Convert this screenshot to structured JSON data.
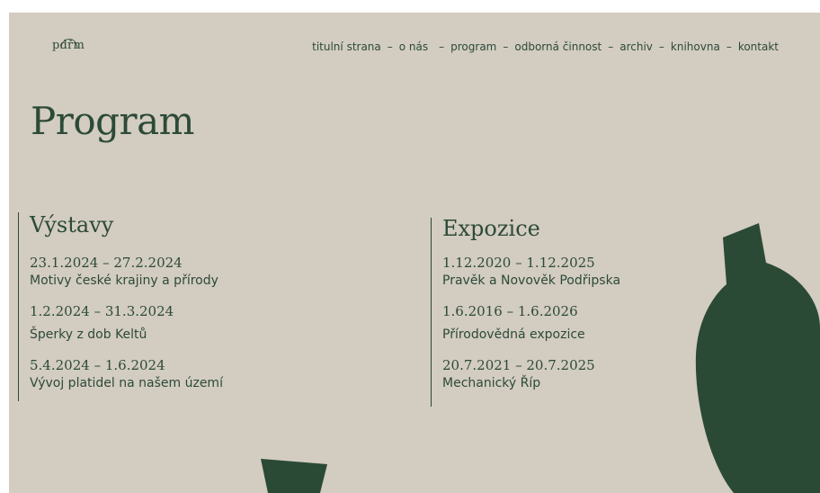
{
  "header": {
    "logo_text": "pdřm",
    "nav": [
      {
        "label": "titulní strana"
      },
      {
        "label": "o nás"
      },
      {
        "label": "program"
      },
      {
        "label": "odborná činnost"
      },
      {
        "label": "archiv"
      },
      {
        "label": "knihovna"
      },
      {
        "label": "kontakt"
      }
    ],
    "separator": "–"
  },
  "main": {
    "title": "Program",
    "vystavy": {
      "title": "Výstavy",
      "items": [
        {
          "date": "23.1.2024 – 27.2.2024",
          "name": "Motivy české krajiny a přírody"
        },
        {
          "date": "1.2.2024 – 31.3.2024",
          "name": "Šperky z dob Keltů"
        },
        {
          "date": "5.4.2024 – 1.6.2024",
          "name": "Vývoj platidel na našem území"
        }
      ]
    },
    "expozice": {
      "title": "Expozice",
      "items": [
        {
          "date": "1.12.2020 – 1.12.2025",
          "name": "Pravěk a Novověk Podřipska"
        },
        {
          "date": "1.6.2016 – 1.6.2026",
          "name": "Přírodovědná expozice"
        },
        {
          "date": "20.7.2021 – 20.7.2025",
          "name": "Mechanický Říp"
        }
      ]
    }
  },
  "colors": {
    "background": "#d3ccc1",
    "accent": "#2c4a38",
    "shape": "#2b4a36"
  }
}
